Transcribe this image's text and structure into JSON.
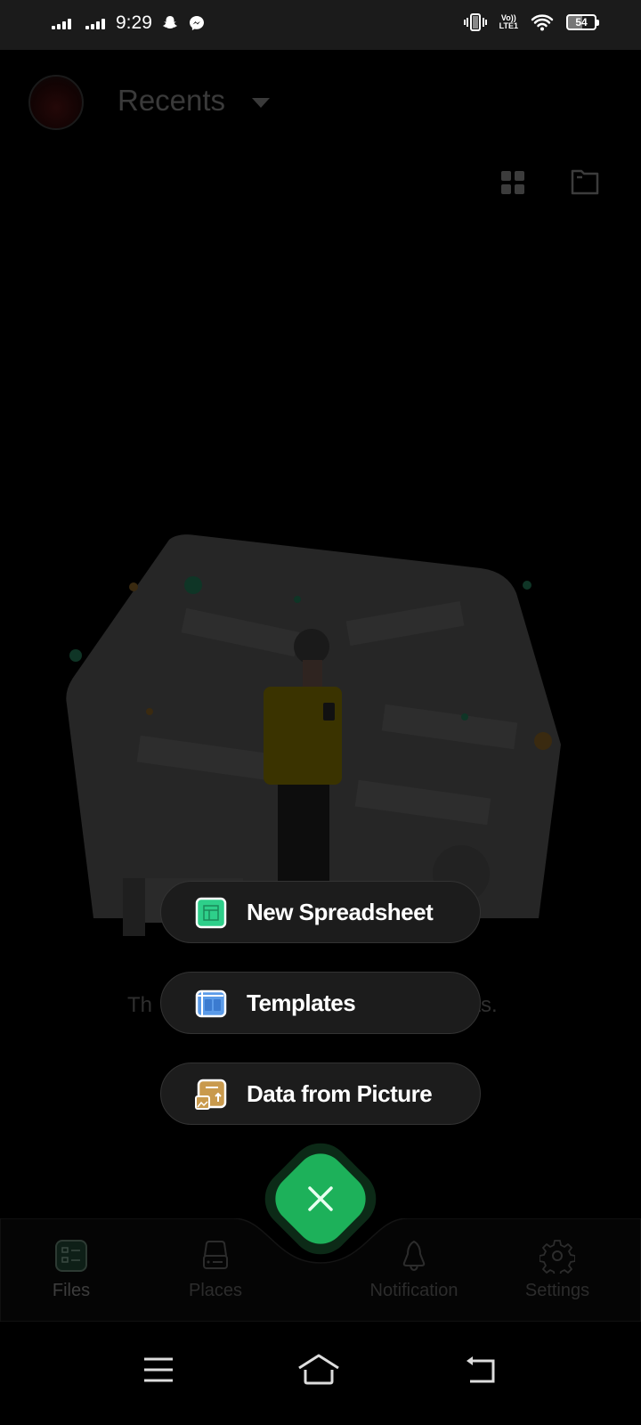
{
  "status_bar": {
    "time": "9:29",
    "notification_icons": [
      "snapchat-icon",
      "messenger-icon"
    ],
    "network_label_top": "Vo))",
    "network_label_bottom": "LTE1",
    "battery_percent": "54"
  },
  "header": {
    "title": "Recents",
    "view_toggle_icon": "grid-icon",
    "folder_icon": "folder-icon"
  },
  "empty_state": {
    "message_left": "Th",
    "message_right": "ets."
  },
  "fab_menu": {
    "options": [
      {
        "label": "New Spreadsheet",
        "icon": "spreadsheet-icon",
        "color": "#2ecf8a"
      },
      {
        "label": "Templates",
        "icon": "templates-icon",
        "color": "#5b9be8"
      },
      {
        "label": "Data from Picture",
        "icon": "picture-data-icon",
        "color": "#c99a4d"
      }
    ],
    "close_icon": "close-icon",
    "accent": "#1db15a"
  },
  "bottom_nav": {
    "items": [
      {
        "label": "Files",
        "icon": "files-icon",
        "active": true
      },
      {
        "label": "Places",
        "icon": "drive-icon",
        "active": false
      },
      {
        "label": "Notification",
        "icon": "bell-icon",
        "active": false
      },
      {
        "label": "Settings",
        "icon": "gear-icon",
        "active": false
      }
    ]
  },
  "system_nav": {
    "buttons": [
      "menu-icon",
      "home-icon",
      "back-icon"
    ]
  }
}
